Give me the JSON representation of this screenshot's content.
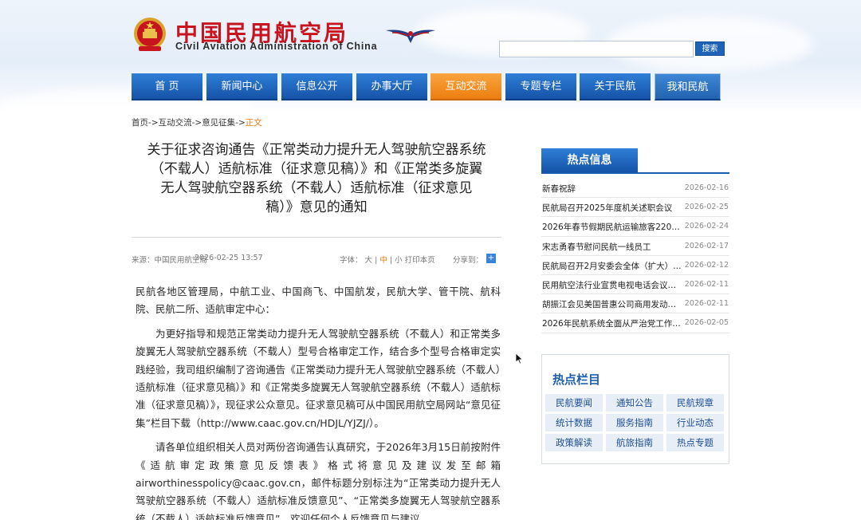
{
  "header": {
    "cn_title": "中国民用航空局",
    "en_title": "Civil Aviation Administration of China",
    "search_button": "搜索",
    "search_placeholder": ""
  },
  "nav": {
    "items": [
      {
        "label": "首 页"
      },
      {
        "label": "新闻中心"
      },
      {
        "label": "信息公开"
      },
      {
        "label": "办事大厅"
      },
      {
        "label": "互动交流",
        "active": true
      },
      {
        "label": "专题专栏"
      },
      {
        "label": "关于民航"
      },
      {
        "label": "我和民航"
      }
    ]
  },
  "breadcrumb": {
    "home": "首页",
    "sep1": "->",
    "level1": "互动交流",
    "sep2": "->",
    "level2": "意见征集",
    "sep3": "->",
    "current": "正文"
  },
  "article": {
    "title_lines": [
      "关于征求咨询通告《正常类动力提升无人驾驶航空器系统",
      "（不载人）适航标准（征求意见稿）》和《正常类多旋翼",
      "无人驾驶航空器系统（不载人）适航标准（征求意见",
      "稿）》意见的通知"
    ],
    "meta": {
      "source": "来源：中国民用航空局",
      "datetime": "2026-02-25 13:57",
      "font_label": "字体：",
      "font_large": "大",
      "sep_a": "|",
      "font_medium": "中",
      "sep_b": "|",
      "font_small": "小",
      "print": "打印本页",
      "share": "分享到："
    },
    "addressee": "民航各地区管理局，中航工业、中国商飞、中国航发，民航大学、管干院、航科院、民航二所、适航审定中心：",
    "para1": "为更好指导和规范正常类动力提升无人驾驶航空器系统（不载人）和正常类多旋翼无人驾驶航空器系统（不载人）型号合格审定工作，结合多个型号合格审定实践经验，我司组织编制了咨询通告《正常类动力提升无人驾驶航空器系统（不载人）适航标准（征求意见稿）》和《正常类多旋翼无人驾驶航空器系统（不载人）适航标准（征求意见稿）》，现征求公众意见。征求意见稿可从中国民用航空局网站“意见征集”栏目下载（http://www.caac.gov.cn/HDJL/YJZJ/）。",
    "para2": "请各单位组织相关人员对两份咨询通告认真研究，于2026年3月15日前按附件《适航审定政策意见反馈表》格式将意见及建议发至邮箱airworthinesspolicy@caac.gov.cn，邮件标题分别标注为“正常类动力提升无人驾驶航空器系统（不载人）适航标准反馈意见”、“正常类多旋翼无人驾驶航空器系统（不载人）适航标准反馈意见”。欢迎任何个人反馈意见与建议。"
  },
  "hot_info": {
    "title": "热点信息",
    "items": [
      {
        "title": "新春祝辞",
        "date": "2026-02-16"
      },
      {
        "title": "民航局召开2025年度机关述职会议",
        "date": "2026-02-25"
      },
      {
        "title": "2026年春节假期民航运输旅客2205…",
        "date": "2026-02-24"
      },
      {
        "title": "宋志勇春节慰问民航一线员工",
        "date": "2026-02-17"
      },
      {
        "title": "民航局召开2月安委会全体（扩大）…",
        "date": "2026-02-12"
      },
      {
        "title": "民用航空法行业宣贯电视电话会议…",
        "date": "2026-02-11"
      },
      {
        "title": "胡振江会见美国普惠公司商用发动…",
        "date": "2026-02-11"
      },
      {
        "title": "2026年民航系统全面从严治党工作…",
        "date": "2026-02-05"
      }
    ]
  },
  "hot_columns": {
    "title": "热点栏目",
    "items": [
      {
        "label": "民航要闻"
      },
      {
        "label": "通知公告"
      },
      {
        "label": "民航规章"
      },
      {
        "label": "统计数据"
      },
      {
        "label": "服务指南"
      },
      {
        "label": "行业动态"
      },
      {
        "label": "政策解读"
      },
      {
        "label": "航旅指南"
      },
      {
        "label": "热点专题"
      }
    ]
  },
  "colors": {
    "brand_red": "#c8141e",
    "nav_blue": "#1553a8",
    "nav_active_orange": "#ec7e10",
    "link_blue": "#1e5fae"
  }
}
